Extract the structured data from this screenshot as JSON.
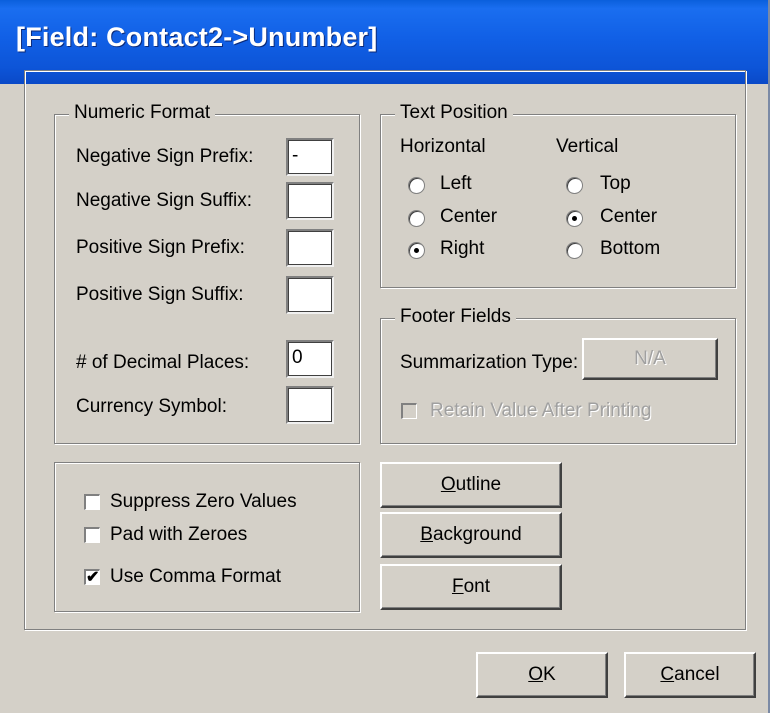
{
  "window": {
    "title": "[Field: Contact2->Unumber]"
  },
  "numeric_format": {
    "legend": "Numeric Format",
    "neg_prefix_label": "Negative Sign Prefix:",
    "neg_prefix_value": "-",
    "neg_suffix_label": "Negative Sign Suffix:",
    "neg_suffix_value": "",
    "pos_prefix_label": "Positive Sign Prefix:",
    "pos_prefix_value": "",
    "pos_suffix_label": "Positive Sign Suffix:",
    "pos_suffix_value": "",
    "decimal_label": "# of Decimal Places:",
    "decimal_value": "0",
    "currency_label": "Currency Symbol:",
    "currency_value": ""
  },
  "text_position": {
    "legend": "Text Position",
    "horizontal_label": "Horizontal",
    "vertical_label": "Vertical",
    "h_left": "Left",
    "h_center": "Center",
    "h_right": "Right",
    "v_top": "Top",
    "v_center": "Center",
    "v_bottom": "Bottom",
    "h_selected": "Right",
    "v_selected": "Center"
  },
  "footer_fields": {
    "legend": "Footer Fields",
    "summarization_label": "Summarization Type:",
    "summarization_value": "N/A",
    "retain_label": "Retain Value After Printing",
    "retain_checked": false
  },
  "options": {
    "suppress_zero_label": "Suppress Zero Values",
    "suppress_zero_checked": false,
    "pad_zeroes_label": "Pad with Zeroes",
    "pad_zeroes_checked": false,
    "comma_label": "Use Comma Format",
    "comma_checked": true,
    "check_mark": "✔"
  },
  "buttons": {
    "outline_accel": "O",
    "outline_rest": "utline",
    "background_accel": "B",
    "background_rest": "ackground",
    "font_accel": "F",
    "font_rest": "ont",
    "ok_accel": "O",
    "ok_rest": "K",
    "cancel_accel": "C",
    "cancel_rest": "ancel"
  }
}
